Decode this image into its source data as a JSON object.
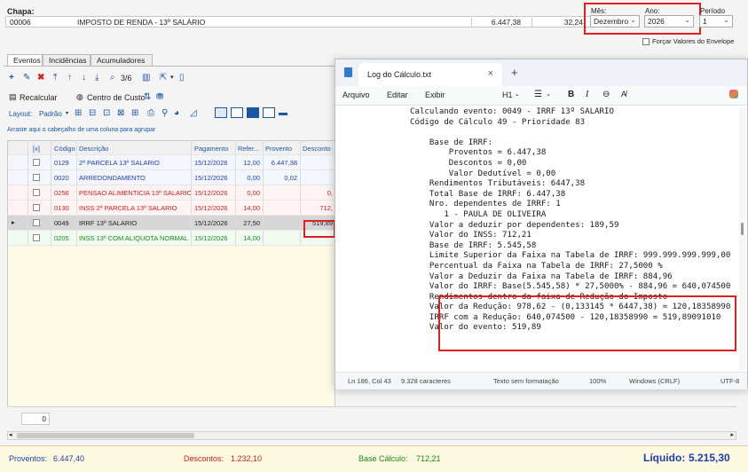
{
  "header": {
    "chapa_label": "Chapa:",
    "chapa_code": "00006",
    "chapa_desc": "IMPOSTO DE RENDA - 13º SALÁRIO",
    "chapa_value": "6.447,38",
    "chapa_rate": "32,24",
    "mes_label": "Mês:",
    "mes_value": "Dezembro",
    "ano_label": "Ano:",
    "ano_value": "2026",
    "periodo_label": "Período",
    "periodo_value": "1",
    "forcar_label": "Forçar Valores do Envelope"
  },
  "tabs": [
    "Eventos",
    "Incidências",
    "Acumuladores"
  ],
  "toolbar": {
    "pager": "3/6",
    "recalcular": "Recalcular",
    "centro_custo": "Centro de Custo",
    "layout_label": "Layout:",
    "layout_value": "Padrão"
  },
  "group_hint": "Arraste aqui o cabeçalho de uma coluna para agrupar",
  "grid": {
    "headers": [
      "[x]",
      "Código",
      "Descrição",
      "Pagamento",
      "Refer...",
      "Provento",
      "Desconto"
    ],
    "rows": [
      {
        "code": "0129",
        "desc": "2ª PARCELA 13º SALARIO",
        "date": "15/12/2026",
        "ref": "12,00",
        "prov": "6.447,38",
        "desc_val": "",
        "color": "#1c3fb0"
      },
      {
        "code": "0020",
        "desc": "ARREDONDAMENTO",
        "date": "15/12/2026",
        "ref": "0,00",
        "prov": "0,02",
        "desc_val": "",
        "color": "#1c3fb0"
      },
      {
        "code": "0256",
        "desc": "PENSAO ALIMENTICIA 13º SALARIO",
        "date": "15/12/2026",
        "ref": "0,00",
        "prov": "",
        "desc_val": "0,",
        "color": "#d42020"
      },
      {
        "code": "0130",
        "desc": "INSS 2ª PARCELA 13º SALARIO",
        "date": "15/12/2026",
        "ref": "14,00",
        "prov": "",
        "desc_val": "712,",
        "color": "#d42020"
      },
      {
        "code": "0049",
        "desc": "IRRF 13º SALARIO",
        "date": "15/12/2026",
        "ref": "27,50",
        "prov": "",
        "desc_val": "519,89",
        "color": "#222222"
      },
      {
        "code": "0205",
        "desc": "INSS 13º COM ALIQUOTA NORMAL",
        "date": "15/12/2026",
        "ref": "14,00",
        "prov": "",
        "desc_val": "",
        "color": "#1a8a1a"
      }
    ],
    "count": "0"
  },
  "footer": {
    "proventos_label": "Proventos:",
    "proventos_value": "6.447,40",
    "descontos_label": "Descontos:",
    "descontos_value": "1.232,10",
    "base_label": "Base Cálculo:",
    "base_value": "712,21",
    "liquido_label": "Líquido:",
    "liquido_value": "5.215,30"
  },
  "notepad": {
    "title": "Log do Cálculo.txt",
    "new_tab": "+",
    "menu": [
      "Arquivo",
      "Editar",
      "Exibir"
    ],
    "heading": "H1",
    "lines": [
      "Calculando evento: 0049 - IRRF 13º SALARIO",
      "Código de Cálculo 49 - Prioridade 83",
      "",
      "    Base de IRRF:",
      "        Proventos = 6.447,38",
      "        Descontos = 0,00",
      "        Valor Dedutível = 0,00",
      "    Rendimentos Tributáveis: 6447,38",
      "    Total Base de IRRF: 6.447,38",
      "    Nro. dependentes de IRRF: 1",
      "       1 - PAULA DE OLIVEIRA",
      "    Valor a deduzir por dependentes: 189,59",
      "    Valor do INSS: 712,21",
      "    Base de IRRF: 5.545,58",
      "    Limite Superior da Faixa na Tabela de IRRF: 999.999.999.999,00",
      "    Percentual da Faixa na Tabela de IRRF: 27,5000 %",
      "    Valor a Deduzir da Faixa na Tabela de IRRF: 884,96",
      "    Valor do IRRF: Base(5.545,58) * 27,5000% - 884,96 = 640,074500",
      "    Rendimentos dentro da faixa de Redução do Imposto",
      "    Valor da Redução: 978,62 - (0,133145 * 6447,38) = 120,18358990",
      "    IRRF com a Redução: 640,074500 - 120,18358990 = 519,89091010",
      "    Valor do evento: 519,89"
    ],
    "status": {
      "position": "Ln 186, Col 43",
      "chars": "9.328 caracteres",
      "format": "Texto sem formatação",
      "zoom": "100%",
      "eol": "Windows (CRLF)",
      "encoding": "UTF-8"
    }
  }
}
